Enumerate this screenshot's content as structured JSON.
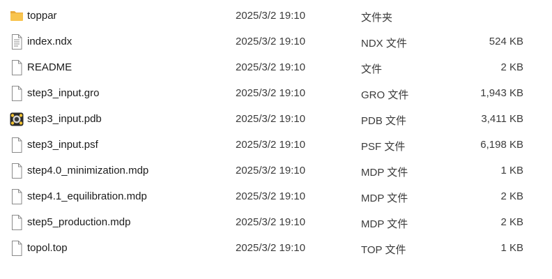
{
  "files": [
    {
      "name": "toppar",
      "date": "2025/3/2 19:10",
      "type": "文件夹",
      "size": "",
      "icon": "folder-icon"
    },
    {
      "name": "index.ndx",
      "date": "2025/3/2 19:10",
      "type": "NDX 文件",
      "size": "524 KB",
      "icon": "text-file-icon"
    },
    {
      "name": "README",
      "date": "2025/3/2 19:10",
      "type": "文件",
      "size": "2 KB",
      "icon": "file-icon"
    },
    {
      "name": "step3_input.gro",
      "date": "2025/3/2 19:10",
      "type": "GRO 文件",
      "size": "1,943 KB",
      "icon": "file-icon"
    },
    {
      "name": "step3_input.pdb",
      "date": "2025/3/2 19:10",
      "type": "PDB 文件",
      "size": "3,411 KB",
      "icon": "pdb-app-icon"
    },
    {
      "name": "step3_input.psf",
      "date": "2025/3/2 19:10",
      "type": "PSF 文件",
      "size": "6,198 KB",
      "icon": "file-icon"
    },
    {
      "name": "step4.0_minimization.mdp",
      "date": "2025/3/2 19:10",
      "type": "MDP 文件",
      "size": "1 KB",
      "icon": "file-icon"
    },
    {
      "name": "step4.1_equilibration.mdp",
      "date": "2025/3/2 19:10",
      "type": "MDP 文件",
      "size": "2 KB",
      "icon": "file-icon"
    },
    {
      "name": "step5_production.mdp",
      "date": "2025/3/2 19:10",
      "type": "MDP 文件",
      "size": "2 KB",
      "icon": "file-icon"
    },
    {
      "name": "topol.top",
      "date": "2025/3/2 19:10",
      "type": "TOP 文件",
      "size": "1 KB",
      "icon": "file-icon"
    }
  ],
  "colors": {
    "folder": "#f8c44f",
    "folder_dark": "#e9a93a",
    "file_outline": "#8a8a8a",
    "row_hover": "#e5f3ff"
  }
}
